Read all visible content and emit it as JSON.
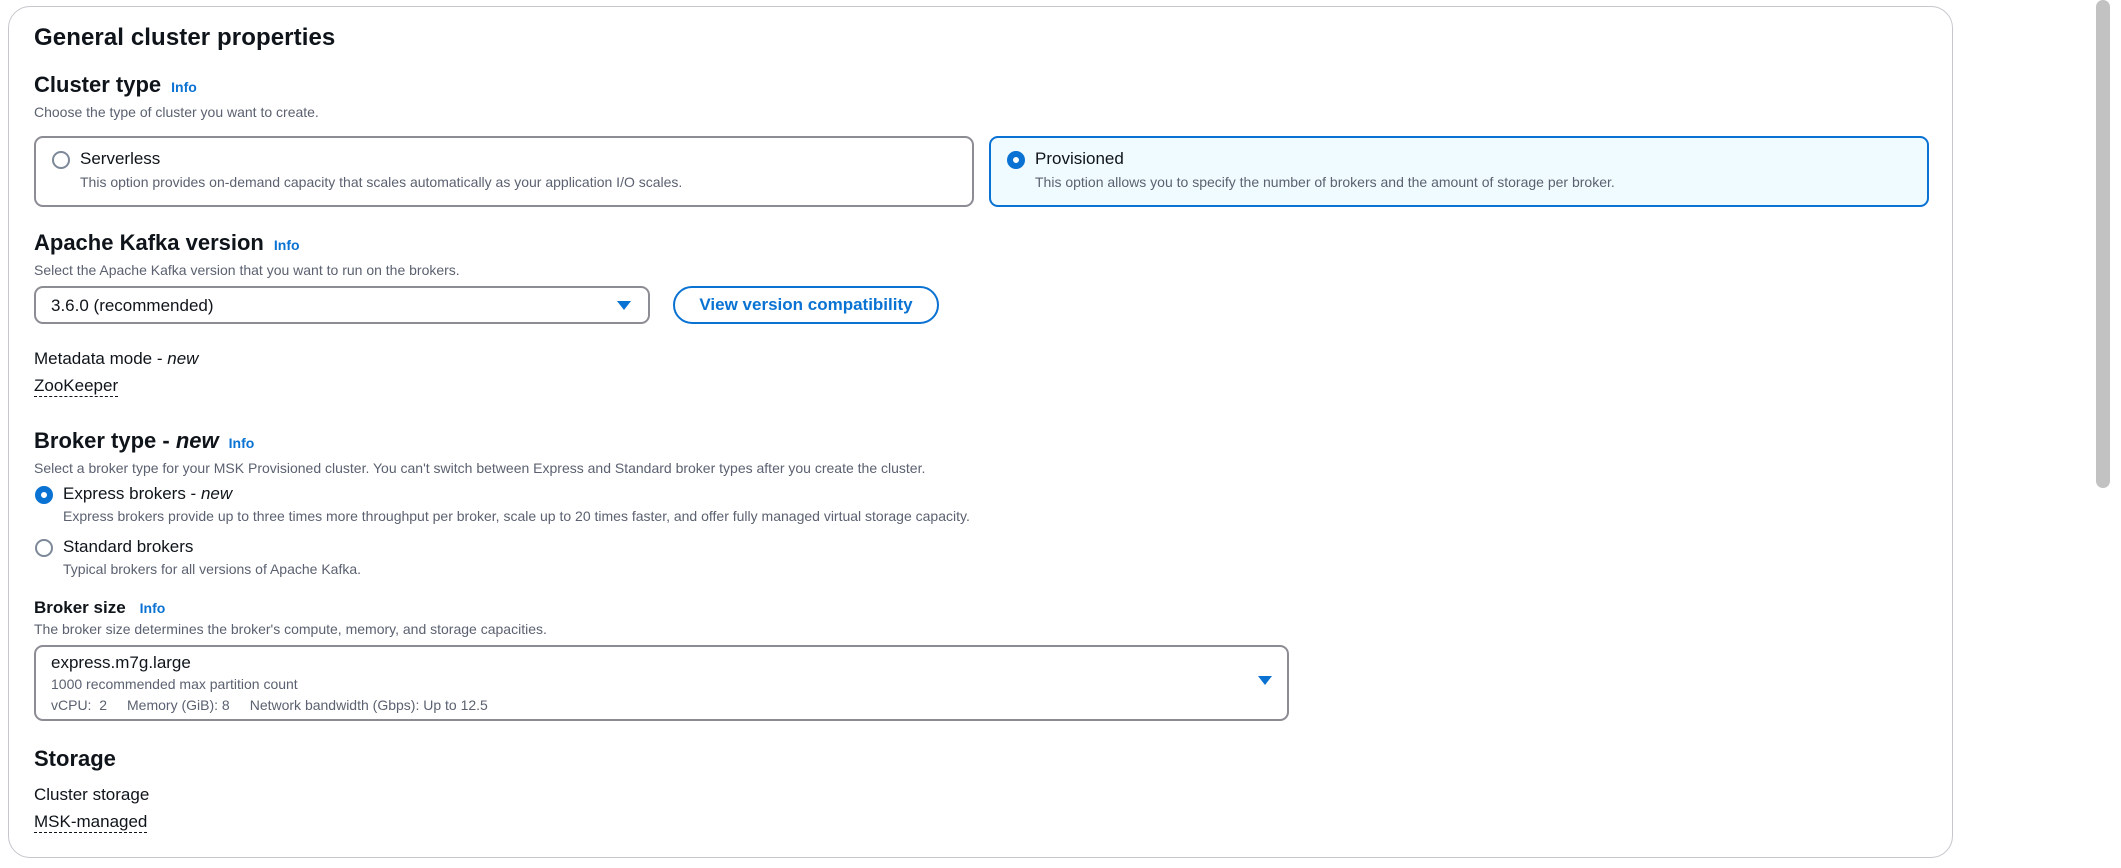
{
  "section_title": "General cluster properties",
  "info_label": "Info",
  "cluster_type": {
    "heading": "Cluster type",
    "description": "Choose the type of cluster you want to create.",
    "options": [
      {
        "title": "Serverless",
        "description": "This option provides on-demand capacity that scales automatically as your application I/O scales.",
        "selected": false
      },
      {
        "title": "Provisioned",
        "description": "This option allows you to specify the number of brokers and the amount of storage per broker.",
        "selected": true
      }
    ]
  },
  "kafka_version": {
    "heading": "Apache Kafka version",
    "description": "Select the Apache Kafka version that you want to run on the brokers.",
    "selected_value": "3.6.0 (recommended)",
    "compat_button": "View version compatibility"
  },
  "metadata_mode": {
    "label": "Metadata mode - ",
    "label_emphasis": "new",
    "value": "ZooKeeper"
  },
  "broker_type": {
    "heading": "Broker type - ",
    "heading_emphasis": "new",
    "description": "Select a broker type for your MSK Provisioned cluster. You can't switch between Express and Standard broker types after you create the cluster.",
    "options": [
      {
        "title": "Express brokers - ",
        "title_emphasis": "new",
        "description": "Express brokers provide up to three times more throughput per broker, scale up to 20 times faster, and offer fully managed virtual storage capacity.",
        "selected": true
      },
      {
        "title": "Standard brokers",
        "title_emphasis": "",
        "description": "Typical brokers for all versions of Apache Kafka.",
        "selected": false
      }
    ]
  },
  "broker_size": {
    "heading": "Broker size",
    "description": "The broker size determines the broker's compute, memory, and storage capacities.",
    "selected_value": "express.m7g.large",
    "detail_partitions": "1000 recommended max partition count",
    "detail_vcpu": "vCPU:  2",
    "detail_memory": "Memory (GiB): 8",
    "detail_network": "Network bandwidth (Gbps): Up to 12.5"
  },
  "storage": {
    "heading": "Storage",
    "label": "Cluster storage",
    "value": "MSK-managed"
  },
  "colors": {
    "accent": "#0972d3",
    "selected_tile_bg": "#f0fbff",
    "border": "#8c8c94",
    "text": "#0f141a",
    "secondary_text": "#5b6170"
  }
}
